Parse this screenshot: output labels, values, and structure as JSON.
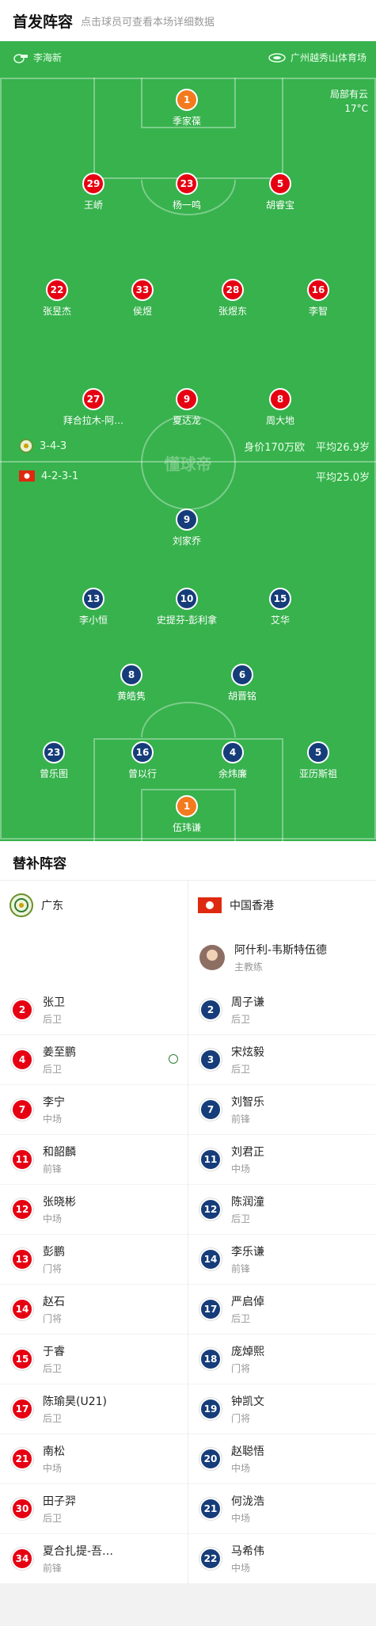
{
  "header": {
    "title": "首发阵容",
    "subtitle": "点击球员可查看本场详细数据"
  },
  "match_info": {
    "referee": "李海新",
    "venue": "广州越秀山体育场",
    "weather": "局部有云",
    "temperature": "17°C",
    "watermark": "懂球帝"
  },
  "home": {
    "formation": "3-4-3",
    "value": "身价170万欧",
    "avg_age": "平均26.9岁",
    "players": [
      {
        "num": "1",
        "name": "季家葆",
        "color": "orange"
      },
      {
        "num": "29",
        "name": "王峤",
        "color": "red"
      },
      {
        "num": "23",
        "name": "杨一鸣",
        "color": "red"
      },
      {
        "num": "5",
        "name": "胡睿宝",
        "color": "red"
      },
      {
        "num": "22",
        "name": "张昱杰",
        "color": "red"
      },
      {
        "num": "33",
        "name": "侯煜",
        "color": "red"
      },
      {
        "num": "28",
        "name": "张煜东",
        "color": "red",
        "captain": "C"
      },
      {
        "num": "16",
        "name": "李智",
        "color": "red"
      },
      {
        "num": "27",
        "name": "拜合拉木-阿…",
        "color": "red"
      },
      {
        "num": "9",
        "name": "夏达龙",
        "color": "red"
      },
      {
        "num": "8",
        "name": "周大地",
        "color": "red"
      }
    ]
  },
  "away": {
    "formation": "4-2-3-1",
    "avg_age": "平均25.0岁",
    "players": [
      {
        "num": "9",
        "name": "刘家乔",
        "color": "navy",
        "ball": true
      },
      {
        "num": "13",
        "name": "李小恒",
        "color": "navy"
      },
      {
        "num": "10",
        "name": "史提芬-彭利拿",
        "color": "navy",
        "captain": "C",
        "ball": true
      },
      {
        "num": "15",
        "name": "艾华",
        "color": "navy"
      },
      {
        "num": "8",
        "name": "黄皓隽",
        "color": "navy"
      },
      {
        "num": "6",
        "name": "胡晋铭",
        "color": "navy"
      },
      {
        "num": "23",
        "name": "曾乐图",
        "color": "navy"
      },
      {
        "num": "16",
        "name": "曾以行",
        "color": "navy"
      },
      {
        "num": "4",
        "name": "余炜廉",
        "color": "navy"
      },
      {
        "num": "5",
        "name": "亚历斯祖",
        "color": "navy"
      },
      {
        "num": "1",
        "name": "伍玮谦",
        "color": "orange"
      }
    ]
  },
  "subs": {
    "title": "替补阵容",
    "home_team": "广东",
    "away_team": "中国香港",
    "coach": {
      "name": "阿什利-韦斯特伍德",
      "role": "主教练"
    },
    "home": [
      {
        "num": "2",
        "name": "张卫",
        "pos": "后卫"
      },
      {
        "num": "4",
        "name": "姜至鹏",
        "pos": "后卫",
        "goal": true
      },
      {
        "num": "7",
        "name": "李宁",
        "pos": "中场"
      },
      {
        "num": "11",
        "name": "和韶麟",
        "pos": "前锋"
      },
      {
        "num": "12",
        "name": "张晓彬",
        "pos": "中场"
      },
      {
        "num": "13",
        "name": "彭鹏",
        "pos": "门将"
      },
      {
        "num": "14",
        "name": "赵石",
        "pos": "门将"
      },
      {
        "num": "15",
        "name": "于睿",
        "pos": "后卫"
      },
      {
        "num": "17",
        "name": "陈瑜昊(U21)",
        "pos": "后卫"
      },
      {
        "num": "21",
        "name": "南松",
        "pos": "中场"
      },
      {
        "num": "30",
        "name": "田子羿",
        "pos": "后卫"
      },
      {
        "num": "34",
        "name": "夏合扎提-吾…",
        "pos": "前锋"
      }
    ],
    "away": [
      {
        "num": "2",
        "name": "周子谦",
        "pos": "后卫"
      },
      {
        "num": "3",
        "name": "宋炫毅",
        "pos": "后卫"
      },
      {
        "num": "7",
        "name": "刘智乐",
        "pos": "前锋"
      },
      {
        "num": "11",
        "name": "刘君正",
        "pos": "中场"
      },
      {
        "num": "12",
        "name": "陈润潼",
        "pos": "后卫"
      },
      {
        "num": "14",
        "name": "李乐谦",
        "pos": "前锋"
      },
      {
        "num": "17",
        "name": "严启倬",
        "pos": "后卫"
      },
      {
        "num": "18",
        "name": "庞焯熙",
        "pos": "门将"
      },
      {
        "num": "19",
        "name": "钟凯文",
        "pos": "门将"
      },
      {
        "num": "20",
        "name": "赵聪悟",
        "pos": "中场"
      },
      {
        "num": "21",
        "name": "何泷浩",
        "pos": "中场"
      },
      {
        "num": "22",
        "name": "马希伟",
        "pos": "中场"
      }
    ]
  }
}
